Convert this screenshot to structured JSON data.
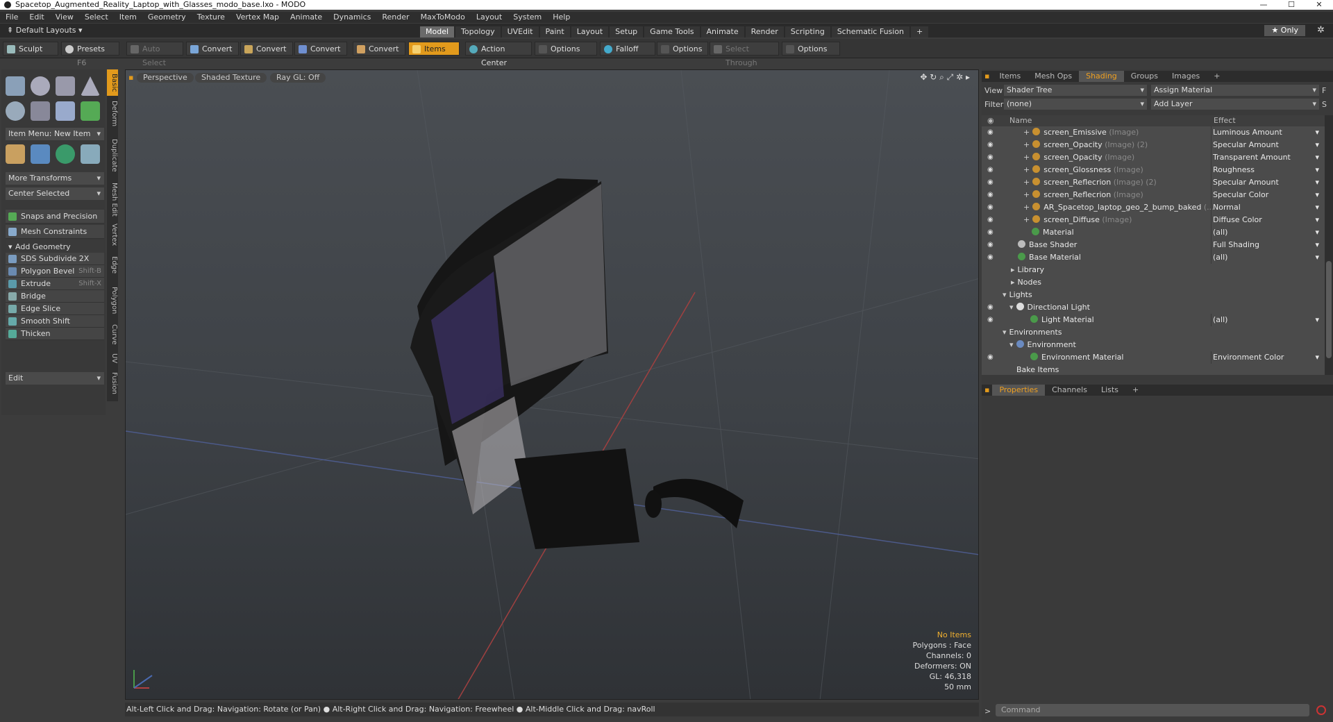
{
  "window": {
    "title": "Spacetop_Augmented_Reality_Laptop_with_Glasses_modo_base.lxo - MODO"
  },
  "menu": [
    "File",
    "Edit",
    "View",
    "Select",
    "Item",
    "Geometry",
    "Texture",
    "Vertex Map",
    "Animate",
    "Dynamics",
    "Render",
    "MaxToModo",
    "Layout",
    "System",
    "Help"
  ],
  "layouts": {
    "label": "Default Layouts",
    "tabs": [
      "Model",
      "Topology",
      "UVEdit",
      "Paint",
      "Layout",
      "Setup",
      "Game Tools",
      "Animate",
      "Render",
      "Scripting",
      "Schematic Fusion"
    ],
    "active": "Model",
    "plus": "+",
    "only": "★ Only"
  },
  "toolbar": {
    "sculpt": "Sculpt",
    "presets": "Presets",
    "presets_key": "F6",
    "auto_select": "Auto Select",
    "convert1": "Convert",
    "convert2": "Convert",
    "convert3": "Convert",
    "convert4": "Convert",
    "items": "Items",
    "action_center": "Action Center",
    "options1": "Options",
    "falloff": "Falloff",
    "options2": "Options",
    "select_through": "Select Through",
    "options3": "Options"
  },
  "left": {
    "item_menu": "Item Menu: New Item",
    "more_transforms": "More Transforms",
    "center_selected": "Center Selected",
    "snaps": "Snaps and Precision",
    "mesh_constraints": "Mesh Constraints",
    "add_geometry": "Add Geometry",
    "tools": [
      {
        "label": "SDS Subdivide 2X",
        "key": ""
      },
      {
        "label": "Polygon Bevel",
        "key": "Shift-B"
      },
      {
        "label": "Extrude",
        "key": "Shift-X"
      },
      {
        "label": "Bridge",
        "key": ""
      },
      {
        "label": "Edge Slice",
        "key": ""
      },
      {
        "label": "Smooth Shift",
        "key": ""
      },
      {
        "label": "Thicken",
        "key": ""
      }
    ],
    "edit": "Edit",
    "vtabs": [
      "Basic",
      "Deform",
      "Duplicate",
      "Mesh Edit",
      "Vertex",
      "Edge",
      "Polygon",
      "Curve",
      "UV",
      "Fusion"
    ]
  },
  "viewport": {
    "perspective": "Perspective",
    "shading": "Shaded Texture",
    "raygl": "Ray GL: Off",
    "info": {
      "no_items": "No Items",
      "polygons": "Polygons : Face",
      "channels": "Channels: 0",
      "deformers": "Deformers: ON",
      "gl": "GL: 46,318",
      "focal": "50 mm"
    }
  },
  "status": "Alt-Left Click and Drag: Navigation: Rotate (or Pan) ● Alt-Right Click and Drag: Navigation: Freewheel ● Alt-Middle Click and Drag: navRoll",
  "right": {
    "tabs": [
      "Items",
      "Mesh Ops",
      "Shading",
      "Groups",
      "Images"
    ],
    "active_tab": "Shading",
    "view_label": "View",
    "view_value": "Shader Tree",
    "assign_material": "Assign Material",
    "f_btn": "F",
    "filter_label": "Filter",
    "filter_value": "(none)",
    "add_layer": "Add Layer",
    "s_btn": "S",
    "col_name": "Name",
    "col_effect": "Effect",
    "rows": [
      {
        "name": "screen_Emissive",
        "sub": "(Image)",
        "effect": "Luminous Amount"
      },
      {
        "name": "screen_Opacity",
        "sub": "(Image) (2)",
        "effect": "Specular Amount"
      },
      {
        "name": "screen_Opacity",
        "sub": "(Image)",
        "effect": "Transparent Amount"
      },
      {
        "name": "screen_Glossness",
        "sub": "(Image)",
        "effect": "Roughness"
      },
      {
        "name": "screen_Reflecrion",
        "sub": "(Image) (2)",
        "effect": "Specular Amount"
      },
      {
        "name": "screen_Reflecrion",
        "sub": "(Image)",
        "effect": "Specular Color"
      },
      {
        "name": "AR_Spacetop_laptop_geo_2_bump_baked",
        "sub": "(...",
        "effect": "Normal"
      },
      {
        "name": "screen_Diffuse",
        "sub": "(Image)",
        "effect": "Diffuse Color"
      }
    ],
    "material": {
      "name": "Material",
      "effect": "(all)"
    },
    "base_shader": {
      "name": "Base Shader",
      "effect": "Full Shading"
    },
    "base_material": {
      "name": "Base Material",
      "effect": "(all)"
    },
    "library": "Library",
    "nodes": "Nodes",
    "lights": "Lights",
    "directional_light": "Directional Light",
    "light_material": {
      "name": "Light Material",
      "effect": "(all)"
    },
    "environments": "Environments",
    "environment": "Environment",
    "env_material": {
      "name": "Environment Material",
      "effect": "Environment Color"
    },
    "bake_items": "Bake Items",
    "prop_tabs": [
      "Properties",
      "Channels",
      "Lists"
    ],
    "active_prop": "Properties",
    "command": "Command"
  },
  "colors": {
    "accent": "#e29a1c",
    "viewport_info": "#f0b030"
  }
}
